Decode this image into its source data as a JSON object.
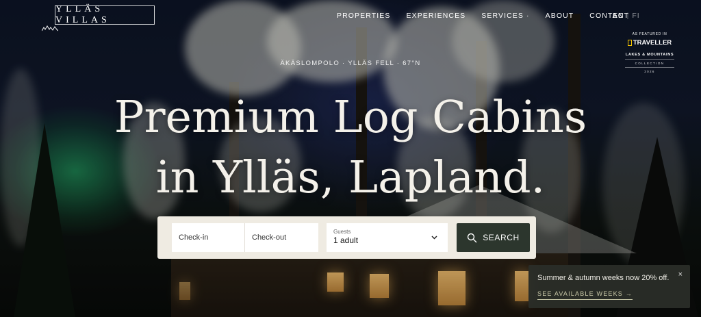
{
  "brand": {
    "name": "YLLÄS VILLAS"
  },
  "nav": {
    "items": [
      {
        "label": "PROPERTIES"
      },
      {
        "label": "EXPERIENCES"
      },
      {
        "label": "SERVICES ·"
      },
      {
        "label": "ABOUT"
      },
      {
        "label": "CONTACT"
      }
    ],
    "lang_active": "EN",
    "lang_separator": "|",
    "lang_other": "FI"
  },
  "featured": {
    "label": "AS FEATURED IN",
    "publication": "TRAVELLER",
    "collection": "LAKES & MOUNTAINS",
    "collection_sub": "COLLECTION",
    "year": "2026"
  },
  "hero": {
    "eyebrow": "ÄKÄSLOMPOLO · YLLÄS FELL · 67°N",
    "headline_line1": "Premium Log Cabins",
    "headline_line2": "in Ylläs, Lapland."
  },
  "booking": {
    "checkin_placeholder": "Check-in",
    "checkout_placeholder": "Check-out",
    "guests_label": "Guests",
    "guests_value": "1 adult",
    "search_label": "SEARCH"
  },
  "toast": {
    "message": "Summer & autumn weeks now 20% off.",
    "link": "SEE AVAILABLE WEEKS →",
    "close": "×"
  },
  "icons": {
    "search": "search-icon",
    "chevron": "chevron-down-icon",
    "close": "close-icon"
  },
  "colors": {
    "button": "#2c362d",
    "booking_bg": "#efebe2",
    "toast_bg": "#2a2e28",
    "toast_link": "#c9c8a8"
  }
}
